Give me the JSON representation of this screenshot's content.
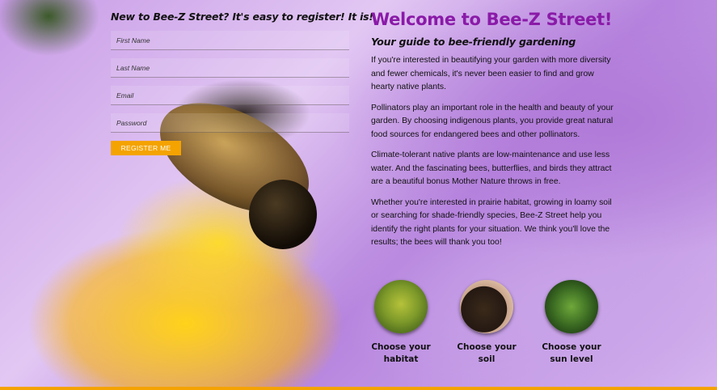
{
  "register": {
    "title": "New to Bee-Z Street? It's easy to register! It is!",
    "fields": [
      {
        "placeholder": "First Name"
      },
      {
        "placeholder": "Last Name"
      },
      {
        "placeholder": "Email"
      },
      {
        "placeholder": "Password"
      }
    ],
    "button_label": "REGISTER ME"
  },
  "main": {
    "title": "Welcome to Bee-Z Street!",
    "subtitle": "Your guide to bee-friendly gardening",
    "paragraphs": [
      "If you're interested in beautifying your garden with more diversity and fewer chemicals, it's never been easier to find and grow hearty native plants.",
      "Pollinators play an important role in the health and beauty of your garden. By choosing indigenous plants, you provide great natural food sources for endangered bees and other pollinators.",
      "Climate-tolerant native plants are low-maintenance and use less water. And the fascinating bees, butterflies, and birds they attract are a beautiful bonus Mother Nature throws in free.",
      "Whether you're interested in prairie habitat, growing in loamy soil or searching for shade-friendly species, Bee-Z Street help you identify the right plants for your situation. We think you'll love the results; the bees will thank you too!"
    ]
  },
  "choices": [
    {
      "line1": "Choose your",
      "line2": "habitat"
    },
    {
      "line1": "Choose your",
      "line2": "soil"
    },
    {
      "line1": "Choose your",
      "line2": "sun level"
    }
  ],
  "colors": {
    "accent": "#f4a300",
    "title": "#8a1aa8"
  }
}
